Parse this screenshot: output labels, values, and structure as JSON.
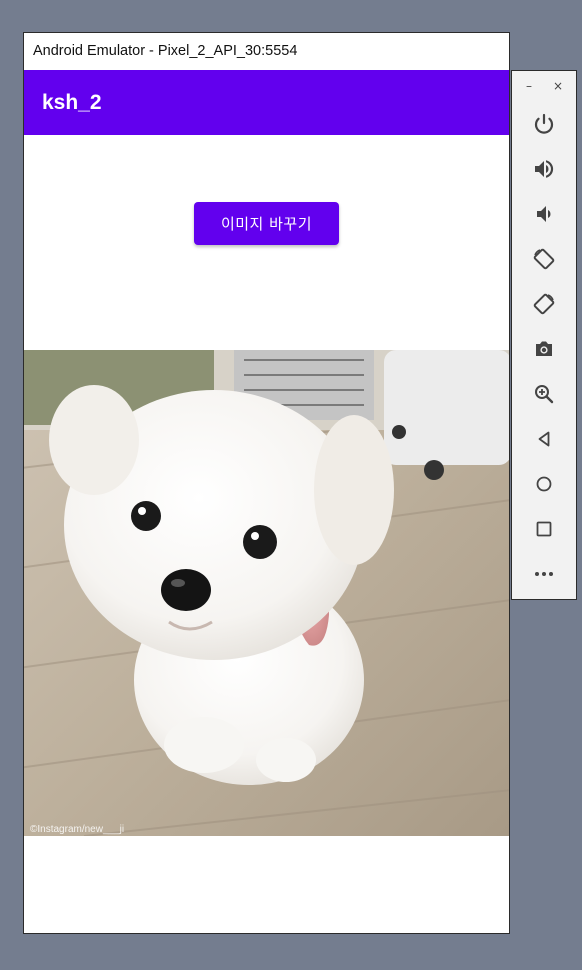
{
  "window": {
    "title": "Android Emulator - Pixel_2_API_30:5554"
  },
  "app": {
    "title": "ksh_2",
    "button_label": "이미지 바꾸기",
    "accent_color": "#6200ee"
  },
  "photo": {
    "watermark": "©Instagram/new___ji"
  },
  "toolbar": {
    "minimize": "–",
    "close": "×",
    "icons": [
      "power-icon",
      "volume-up-icon",
      "volume-down-icon",
      "rotate-left-icon",
      "rotate-right-icon",
      "camera-icon",
      "zoom-icon",
      "back-icon",
      "home-icon",
      "overview-icon",
      "more-icon"
    ]
  }
}
